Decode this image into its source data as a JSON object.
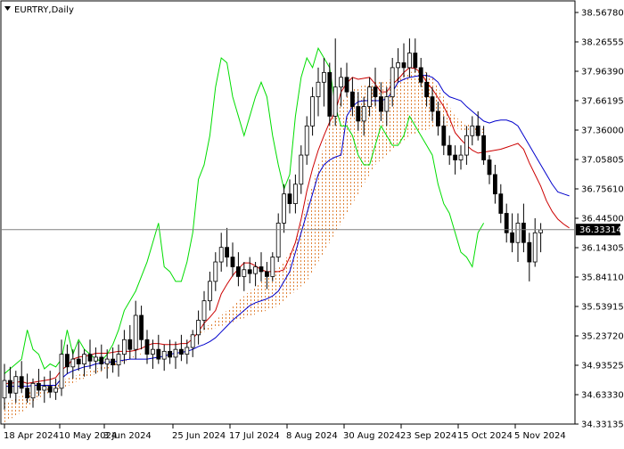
{
  "chart_data": {
    "type": "candlestick",
    "symbol_title": "EURTRY,Daily",
    "current_price": "36.33314",
    "price_axis_ticks": [
      "38.56780",
      "38.26555",
      "37.96390",
      "37.66195",
      "37.36000",
      "37.05805",
      "36.75610",
      "36.44500",
      "36.14305",
      "35.84110",
      "35.53915",
      "35.23720",
      "34.93525",
      "34.63330",
      "34.33135"
    ],
    "date_axis_ticks": [
      "18 Apr 2024",
      "10 May 2024",
      "3 Jun 2024",
      "25 Jun 2024",
      "17 Jul 2024",
      "8 Aug 2024",
      "30 Aug 2024",
      "23 Sep 2024",
      "15 Oct 2024",
      "5 Nov 2024"
    ],
    "ylim": [
      34.33135,
      38.5678
    ],
    "overlays": [
      {
        "type": "tenkan_sen",
        "color": "#cc0000",
        "values": [
          34.75,
          34.75,
          34.76,
          34.77,
          34.75,
          34.76,
          34.77,
          34.78,
          34.79,
          34.81,
          34.89,
          34.93,
          35.0,
          35.02,
          35.03,
          35.04,
          35.06,
          35.06,
          35.06,
          35.07,
          35.08,
          35.08,
          35.08,
          35.09,
          35.11,
          35.14,
          35.16,
          35.16,
          35.15,
          35.15,
          35.15,
          35.16,
          35.16,
          35.21,
          35.28,
          35.37,
          35.43,
          35.5,
          35.67,
          35.77,
          35.86,
          35.93,
          35.99,
          35.99,
          35.96,
          35.92,
          35.9,
          35.9,
          35.9,
          35.92,
          36.05,
          36.2,
          36.44,
          36.73,
          36.96,
          37.15,
          37.3,
          37.44,
          37.55,
          37.75,
          37.84,
          37.9,
          37.88,
          37.89,
          37.9,
          37.83,
          37.75,
          37.75,
          37.83,
          37.88,
          37.95,
          38.0,
          37.99,
          37.95,
          37.85,
          37.78,
          37.69,
          37.6,
          37.48,
          37.33,
          37.26,
          37.2,
          37.15,
          37.12,
          37.13,
          37.14,
          37.15,
          37.16,
          37.18,
          37.2,
          37.22,
          37.16,
          37.02,
          36.9,
          36.78,
          36.63,
          36.52,
          36.44,
          36.39,
          36.35
        ]
      },
      {
        "type": "kijun_sen",
        "color": "#0000cc",
        "values": [
          34.72,
          34.72,
          34.72,
          34.72,
          34.72,
          34.73,
          34.73,
          34.73,
          34.73,
          34.73,
          34.8,
          34.85,
          34.88,
          34.9,
          34.92,
          34.93,
          34.95,
          34.96,
          34.97,
          34.97,
          34.98,
          34.99,
          35.0,
          35.0,
          35.0,
          35.0,
          35.01,
          35.02,
          35.03,
          35.05,
          35.06,
          35.07,
          35.08,
          35.1,
          35.13,
          35.15,
          35.18,
          35.22,
          35.28,
          35.34,
          35.4,
          35.45,
          35.5,
          35.55,
          35.58,
          35.6,
          35.62,
          35.65,
          35.7,
          35.8,
          35.9,
          36.1,
          36.3,
          36.5,
          36.7,
          36.9,
          37.0,
          37.05,
          37.08,
          37.1,
          37.5,
          37.6,
          37.65,
          37.66,
          37.66,
          37.66,
          37.66,
          37.68,
          37.75,
          37.85,
          37.88,
          37.9,
          37.91,
          37.92,
          37.92,
          37.9,
          37.85,
          37.75,
          37.7,
          37.68,
          37.66,
          37.6,
          37.55,
          37.5,
          37.45,
          37.43,
          37.45,
          37.46,
          37.46,
          37.44,
          37.4,
          37.3,
          37.2,
          37.1,
          37.0,
          36.9,
          36.8,
          36.72,
          36.7,
          36.68
        ]
      },
      {
        "type": "chikou_span",
        "color": "#00dd00",
        "values": [
          34.85,
          34.9,
          34.95,
          35.0,
          35.3,
          35.1,
          35.05,
          34.9,
          34.95,
          34.92,
          35.0,
          35.3,
          35.05,
          35.2,
          35.1,
          35.05,
          35.0,
          34.98,
          35.05,
          35.15,
          35.3,
          35.5,
          35.6,
          35.7,
          35.85,
          36.0,
          36.2,
          36.4,
          35.95,
          35.9,
          35.8,
          35.8,
          36.0,
          36.3,
          36.85,
          37.0,
          37.3,
          37.8,
          38.1,
          38.05,
          37.7,
          37.5,
          37.3,
          37.5,
          37.7,
          37.85,
          37.7,
          37.3,
          37.0,
          36.75,
          36.9,
          37.5,
          37.9,
          38.1,
          38.0,
          38.2,
          38.1,
          38.0,
          37.6,
          37.4,
          37.4,
          37.3,
          37.1,
          37.0,
          37.0,
          37.2,
          37.4,
          37.3,
          37.2,
          37.2,
          37.3,
          37.5,
          37.4,
          37.3,
          37.2,
          37.1,
          36.8,
          36.6,
          36.5,
          36.3,
          36.1,
          36.05,
          35.95,
          36.3,
          36.4
        ]
      },
      {
        "type": "senkou_span_a",
        "color": "#e08020",
        "values": [
          34.35,
          34.38,
          34.42,
          34.45,
          34.5,
          34.55,
          34.6,
          34.63,
          34.66,
          34.68,
          34.7,
          34.72,
          34.75,
          34.78,
          34.8,
          34.82,
          34.85,
          34.87,
          34.9,
          34.92,
          34.95,
          34.97,
          35.0,
          35.03,
          35.05,
          35.08,
          35.1,
          35.12,
          35.14,
          35.16,
          35.18,
          35.2,
          35.22,
          35.25,
          35.28,
          35.32,
          35.36,
          35.4,
          35.45,
          35.5,
          35.55,
          35.6,
          35.65,
          35.7,
          35.75,
          35.8,
          35.85,
          35.9,
          35.95,
          36.0,
          36.1,
          36.2,
          36.4,
          36.6,
          36.8,
          37.0,
          37.2,
          37.4,
          37.55,
          37.65,
          37.72,
          37.78,
          37.8,
          37.82,
          37.83,
          37.85,
          37.86,
          37.87,
          37.88,
          37.9,
          37.92,
          37.95,
          37.97,
          37.98,
          37.95,
          37.9,
          37.8,
          37.7,
          37.6,
          37.5,
          37.45,
          37.42,
          37.4,
          37.38,
          37.37
        ]
      },
      {
        "type": "senkou_span_b",
        "color": "#e08020",
        "values": [
          34.55,
          34.57,
          34.6,
          34.62,
          34.65,
          34.67,
          34.7,
          34.72,
          34.74,
          34.76,
          34.78,
          34.8,
          34.82,
          34.84,
          34.86,
          34.88,
          34.9,
          34.92,
          34.94,
          34.96,
          34.98,
          35.0,
          35.02,
          35.04,
          35.06,
          35.08,
          35.1,
          35.12,
          35.14,
          35.16,
          35.18,
          35.2,
          35.22,
          35.24,
          35.26,
          35.28,
          35.3,
          35.32,
          35.34,
          35.36,
          35.38,
          35.4,
          35.42,
          35.44,
          35.46,
          35.48,
          35.5,
          35.52,
          35.55,
          35.6,
          35.65,
          35.7,
          35.75,
          35.8,
          35.9,
          36.0,
          36.1,
          36.2,
          36.3,
          36.4,
          36.5,
          36.6,
          36.7,
          36.8,
          36.9,
          37.0,
          37.05,
          37.1,
          37.15,
          37.2,
          37.25,
          37.3,
          37.32,
          37.34,
          37.36,
          37.38,
          37.4,
          37.4,
          37.4,
          37.38,
          37.36,
          37.35,
          37.34,
          37.33,
          37.33
        ]
      }
    ],
    "candles": [
      {
        "o": 34.6,
        "h": 34.95,
        "l": 34.48,
        "c": 34.78
      },
      {
        "o": 34.78,
        "h": 34.92,
        "l": 34.6,
        "c": 34.65
      },
      {
        "o": 34.65,
        "h": 34.88,
        "l": 34.55,
        "c": 34.82
      },
      {
        "o": 34.82,
        "h": 34.98,
        "l": 34.65,
        "c": 34.7
      },
      {
        "o": 34.7,
        "h": 34.85,
        "l": 34.55,
        "c": 34.6
      },
      {
        "o": 34.6,
        "h": 34.8,
        "l": 34.5,
        "c": 34.75
      },
      {
        "o": 34.75,
        "h": 34.9,
        "l": 34.62,
        "c": 34.68
      },
      {
        "o": 34.68,
        "h": 34.82,
        "l": 34.55,
        "c": 34.72
      },
      {
        "o": 34.72,
        "h": 34.88,
        "l": 34.6,
        "c": 34.66
      },
      {
        "o": 34.66,
        "h": 34.8,
        "l": 34.58,
        "c": 34.7
      },
      {
        "o": 34.7,
        "h": 35.2,
        "l": 34.62,
        "c": 35.05
      },
      {
        "o": 35.05,
        "h": 35.15,
        "l": 34.85,
        "c": 34.92
      },
      {
        "o": 34.92,
        "h": 35.1,
        "l": 34.8,
        "c": 35.0
      },
      {
        "o": 35.0,
        "h": 35.18,
        "l": 34.88,
        "c": 34.95
      },
      {
        "o": 34.95,
        "h": 35.1,
        "l": 34.82,
        "c": 35.05
      },
      {
        "o": 35.05,
        "h": 35.2,
        "l": 34.9,
        "c": 34.98
      },
      {
        "o": 34.98,
        "h": 35.12,
        "l": 34.85,
        "c": 35.02
      },
      {
        "o": 35.02,
        "h": 35.15,
        "l": 34.88,
        "c": 34.95
      },
      {
        "o": 34.95,
        "h": 35.1,
        "l": 34.8,
        "c": 35.0
      },
      {
        "o": 35.0,
        "h": 35.12,
        "l": 34.86,
        "c": 34.94
      },
      {
        "o": 34.94,
        "h": 35.15,
        "l": 34.82,
        "c": 35.05
      },
      {
        "o": 35.05,
        "h": 35.3,
        "l": 34.95,
        "c": 35.2
      },
      {
        "o": 35.2,
        "h": 35.35,
        "l": 35.0,
        "c": 35.1
      },
      {
        "o": 35.1,
        "h": 35.6,
        "l": 35.0,
        "c": 35.45
      },
      {
        "o": 35.45,
        "h": 35.55,
        "l": 35.1,
        "c": 35.2
      },
      {
        "o": 35.2,
        "h": 35.3,
        "l": 34.95,
        "c": 35.05
      },
      {
        "o": 35.05,
        "h": 35.2,
        "l": 34.9,
        "c": 35.1
      },
      {
        "o": 35.1,
        "h": 35.25,
        "l": 34.95,
        "c": 35.0
      },
      {
        "o": 35.0,
        "h": 35.15,
        "l": 34.88,
        "c": 35.08
      },
      {
        "o": 35.08,
        "h": 35.2,
        "l": 34.95,
        "c": 35.02
      },
      {
        "o": 35.02,
        "h": 35.18,
        "l": 34.9,
        "c": 35.1
      },
      {
        "o": 35.1,
        "h": 35.25,
        "l": 34.98,
        "c": 35.05
      },
      {
        "o": 35.05,
        "h": 35.2,
        "l": 34.95,
        "c": 35.12
      },
      {
        "o": 35.12,
        "h": 35.3,
        "l": 35.02,
        "c": 35.25
      },
      {
        "o": 35.25,
        "h": 35.5,
        "l": 35.15,
        "c": 35.4
      },
      {
        "o": 35.4,
        "h": 35.7,
        "l": 35.3,
        "c": 35.6
      },
      {
        "o": 35.6,
        "h": 35.9,
        "l": 35.5,
        "c": 35.8
      },
      {
        "o": 35.8,
        "h": 36.1,
        "l": 35.7,
        "c": 36.0
      },
      {
        "o": 36.0,
        "h": 36.3,
        "l": 35.9,
        "c": 36.15
      },
      {
        "o": 36.15,
        "h": 36.35,
        "l": 35.95,
        "c": 36.05
      },
      {
        "o": 36.05,
        "h": 36.2,
        "l": 35.85,
        "c": 35.95
      },
      {
        "o": 35.95,
        "h": 36.1,
        "l": 35.75,
        "c": 35.85
      },
      {
        "o": 35.85,
        "h": 36.0,
        "l": 35.7,
        "c": 35.92
      },
      {
        "o": 35.92,
        "h": 36.05,
        "l": 35.78,
        "c": 35.88
      },
      {
        "o": 35.88,
        "h": 36.0,
        "l": 35.75,
        "c": 35.95
      },
      {
        "o": 35.95,
        "h": 36.1,
        "l": 35.8,
        "c": 35.9
      },
      {
        "o": 35.9,
        "h": 36.0,
        "l": 35.72,
        "c": 35.85
      },
      {
        "o": 35.85,
        "h": 36.1,
        "l": 35.8,
        "c": 36.05
      },
      {
        "o": 36.05,
        "h": 36.5,
        "l": 36.0,
        "c": 36.4
      },
      {
        "o": 36.4,
        "h": 36.8,
        "l": 36.3,
        "c": 36.7
      },
      {
        "o": 36.7,
        "h": 36.85,
        "l": 36.5,
        "c": 36.6
      },
      {
        "o": 36.6,
        "h": 36.9,
        "l": 36.5,
        "c": 36.8
      },
      {
        "o": 36.8,
        "h": 37.2,
        "l": 36.7,
        "c": 37.1
      },
      {
        "o": 37.1,
        "h": 37.5,
        "l": 37.0,
        "c": 37.4
      },
      {
        "o": 37.4,
        "h": 37.8,
        "l": 37.3,
        "c": 37.7
      },
      {
        "o": 37.7,
        "h": 38.0,
        "l": 37.5,
        "c": 37.85
      },
      {
        "o": 37.85,
        "h": 38.1,
        "l": 37.6,
        "c": 37.95
      },
      {
        "o": 37.95,
        "h": 38.05,
        "l": 37.4,
        "c": 37.5
      },
      {
        "o": 37.5,
        "h": 38.3,
        "l": 37.4,
        "c": 37.8
      },
      {
        "o": 37.8,
        "h": 38.0,
        "l": 37.6,
        "c": 37.9
      },
      {
        "o": 37.9,
        "h": 38.05,
        "l": 37.7,
        "c": 37.75
      },
      {
        "o": 37.75,
        "h": 37.9,
        "l": 37.5,
        "c": 37.6
      },
      {
        "o": 37.6,
        "h": 37.75,
        "l": 37.35,
        "c": 37.45
      },
      {
        "o": 37.45,
        "h": 37.7,
        "l": 37.3,
        "c": 37.6
      },
      {
        "o": 37.6,
        "h": 37.9,
        "l": 37.5,
        "c": 37.8
      },
      {
        "o": 37.8,
        "h": 38.0,
        "l": 37.6,
        "c": 37.7
      },
      {
        "o": 37.7,
        "h": 37.85,
        "l": 37.45,
        "c": 37.55
      },
      {
        "o": 37.55,
        "h": 37.8,
        "l": 37.4,
        "c": 37.7
      },
      {
        "o": 37.7,
        "h": 38.1,
        "l": 37.6,
        "c": 38.0
      },
      {
        "o": 38.0,
        "h": 38.2,
        "l": 37.85,
        "c": 38.05
      },
      {
        "o": 38.05,
        "h": 38.25,
        "l": 37.9,
        "c": 38.0
      },
      {
        "o": 38.0,
        "h": 38.3,
        "l": 37.9,
        "c": 38.15
      },
      {
        "o": 38.15,
        "h": 38.3,
        "l": 37.95,
        "c": 38.0
      },
      {
        "o": 38.0,
        "h": 38.1,
        "l": 37.8,
        "c": 37.85
      },
      {
        "o": 37.85,
        "h": 37.95,
        "l": 37.6,
        "c": 37.7
      },
      {
        "o": 37.7,
        "h": 37.8,
        "l": 37.45,
        "c": 37.55
      },
      {
        "o": 37.55,
        "h": 37.65,
        "l": 37.3,
        "c": 37.4
      },
      {
        "o": 37.4,
        "h": 37.5,
        "l": 37.1,
        "c": 37.2
      },
      {
        "o": 37.2,
        "h": 37.3,
        "l": 37.0,
        "c": 37.1
      },
      {
        "o": 37.1,
        "h": 37.2,
        "l": 36.9,
        "c": 37.05
      },
      {
        "o": 37.05,
        "h": 37.2,
        "l": 36.95,
        "c": 37.1
      },
      {
        "o": 37.1,
        "h": 37.4,
        "l": 37.0,
        "c": 37.3
      },
      {
        "o": 37.3,
        "h": 37.5,
        "l": 37.2,
        "c": 37.4
      },
      {
        "o": 37.4,
        "h": 37.55,
        "l": 37.25,
        "c": 37.3
      },
      {
        "o": 37.3,
        "h": 37.4,
        "l": 37.0,
        "c": 37.05
      },
      {
        "o": 37.05,
        "h": 37.1,
        "l": 36.8,
        "c": 36.9
      },
      {
        "o": 36.9,
        "h": 37.0,
        "l": 36.6,
        "c": 36.7
      },
      {
        "o": 36.7,
        "h": 36.8,
        "l": 36.4,
        "c": 36.5
      },
      {
        "o": 36.5,
        "h": 36.6,
        "l": 36.2,
        "c": 36.3
      },
      {
        "o": 36.3,
        "h": 36.5,
        "l": 36.1,
        "c": 36.2
      },
      {
        "o": 36.2,
        "h": 36.5,
        "l": 36.0,
        "c": 36.4
      },
      {
        "o": 36.4,
        "h": 36.6,
        "l": 36.1,
        "c": 36.2
      },
      {
        "o": 36.2,
        "h": 36.3,
        "l": 35.8,
        "c": 36.0
      },
      {
        "o": 36.0,
        "h": 36.45,
        "l": 35.95,
        "c": 36.3
      },
      {
        "o": 36.3,
        "h": 36.4,
        "l": 36.1,
        "c": 36.33
      }
    ],
    "colors": {
      "bullish_fill": "#ffffff",
      "bearish_fill": "#000000",
      "candle_outline": "#000000",
      "price_line": "#808080"
    }
  }
}
